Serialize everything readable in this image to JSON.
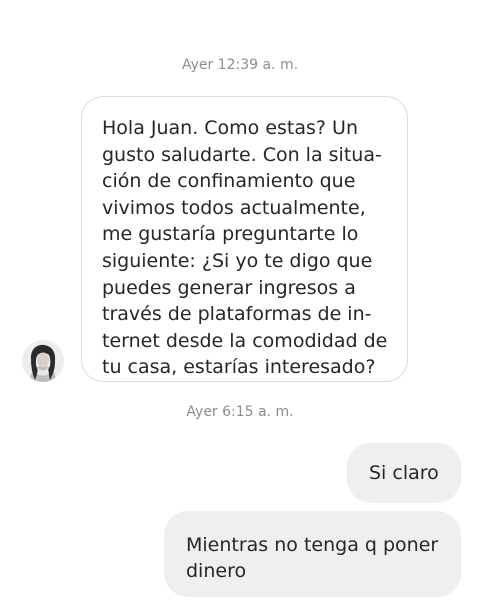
{
  "conversation": {
    "timestamps": [
      "Ayer 12:39 a. m.",
      "Ayer 6:15 a. m."
    ],
    "incoming_message": "Hola Juan. Como estas? Un\ngusto saludarte. Con la situa-\nción de confinamiento que\nvivimos todos actualmente,\nme gustaría preguntarte lo\nsiguiente: ¿Si yo te digo que\npuedes generar ingresos a\ntravés de plataformas de in-\nternet desde la comodidad de\ntu casa, estarías interesado?",
    "outgoing_messages": [
      "Si claro",
      "Mientras no tenga q poner\ndinero"
    ]
  },
  "colors": {
    "background": "#ffffff",
    "incoming_border": "#dbdbdb",
    "outgoing_bubble": "#efefef",
    "timestamp": "#8e8e8e",
    "text": "#262626"
  },
  "icons": {
    "avatar": "profile-photo"
  }
}
